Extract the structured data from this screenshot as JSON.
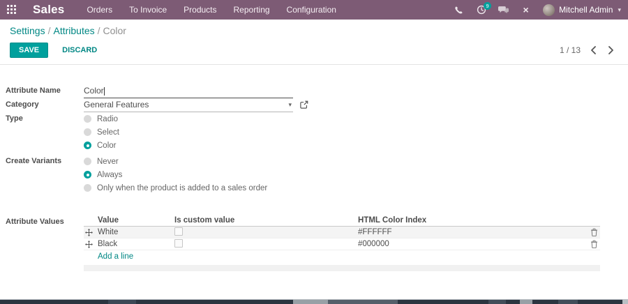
{
  "navbar": {
    "brand": "Sales",
    "menu": [
      "Orders",
      "To Invoice",
      "Products",
      "Reporting",
      "Configuration"
    ],
    "activity_badge": "9",
    "user_name": "Mitchell Admin"
  },
  "breadcrumb": {
    "settings": "Settings",
    "attributes": "Attributes",
    "current": "Color",
    "separator": "/"
  },
  "actions": {
    "save": "SAVE",
    "discard": "DISCARD",
    "pager": "1 / 13"
  },
  "form": {
    "attribute_name": {
      "label": "Attribute Name",
      "value": "Color"
    },
    "category": {
      "label": "Category",
      "value": "General Features"
    },
    "type": {
      "label": "Type",
      "options": [
        {
          "label": "Radio",
          "selected": false
        },
        {
          "label": "Select",
          "selected": false
        },
        {
          "label": "Color",
          "selected": true
        }
      ]
    },
    "create_variants": {
      "label": "Create Variants",
      "options": [
        {
          "label": "Never",
          "selected": false
        },
        {
          "label": "Always",
          "selected": true
        },
        {
          "label": "Only when the product is added to a sales order",
          "selected": false
        }
      ]
    },
    "attribute_values": {
      "label": "Attribute Values",
      "headers": {
        "value": "Value",
        "is_custom": "Is custom value",
        "color_index": "HTML Color Index"
      },
      "rows": [
        {
          "value": "White",
          "is_custom": false,
          "color_index": "#FFFFFF"
        },
        {
          "value": "Black",
          "is_custom": false,
          "color_index": "#000000"
        }
      ],
      "add_line": "Add a line"
    }
  },
  "colors": {
    "navbar": "#7d5b75",
    "accent": "#00a09d",
    "link": "#008784"
  }
}
